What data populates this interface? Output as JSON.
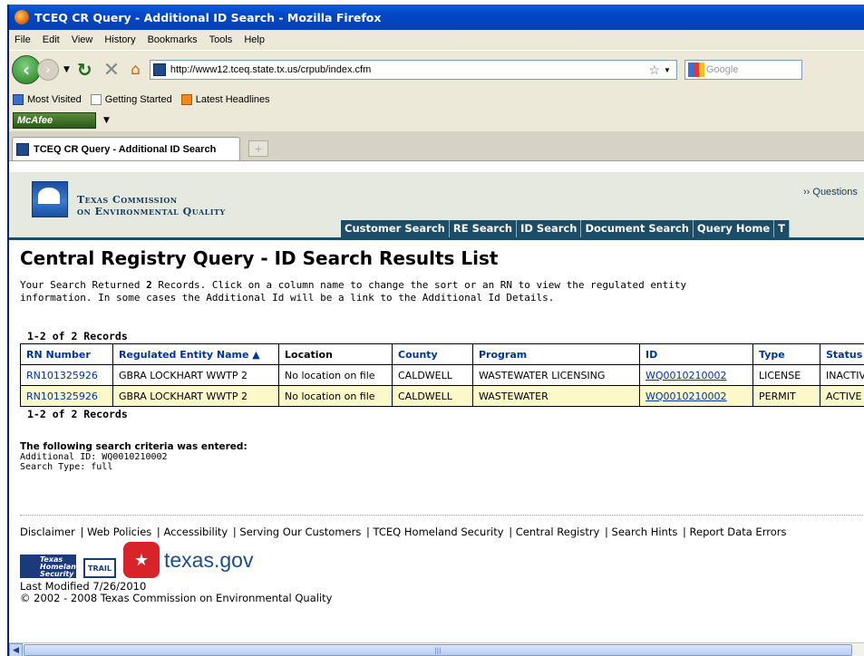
{
  "window": {
    "title": "TCEQ CR Query - Additional ID Search - Mozilla Firefox"
  },
  "menu": [
    "File",
    "Edit",
    "View",
    "History",
    "Bookmarks",
    "Tools",
    "Help"
  ],
  "navbar": {
    "url": "http://www12.tceq.state.tx.us/crpub/index.cfm",
    "search_placeholder": "Google"
  },
  "bookmarks": [
    "Most Visited",
    "Getting Started",
    "Latest Headlines"
  ],
  "mcafee": {
    "label": "McAfee"
  },
  "tab": {
    "title": "TCEQ CR Query - Additional ID Search",
    "new_tab": "+"
  },
  "site": {
    "org_line1": "Texas Commission",
    "org_line2": "on Environmental Quality",
    "questions": "›› Questions",
    "nav": [
      "Customer Search",
      "RE Search",
      "ID Search",
      "Document Search",
      "Query Home",
      "T"
    ]
  },
  "main": {
    "title": "Central Registry Query - ID Search Results List",
    "desc_prefix": "Your Search Returned ",
    "desc_count": "2",
    "desc_suffix": " Records. Click on a column name to change the sort or an RN to view the regulated entity information. In some cases the Additional Id will be a link to the Additional Id Details.",
    "records_label": "1-2 of 2 Records",
    "columns": [
      "RN Number",
      "Regulated Entity Name ▲",
      "Location",
      "County",
      "Program",
      "ID",
      "Type",
      "Status"
    ],
    "rows": [
      [
        "RN101325926",
        "GBRA LOCKHART WWTP 2",
        "No location on file",
        "CALDWELL",
        "WASTEWATER LICENSING",
        "WQ0010210002",
        "LICENSE",
        "INACTIVE"
      ],
      [
        "RN101325926",
        "GBRA LOCKHART WWTP 2",
        "No location on file",
        "CALDWELL",
        "WASTEWATER",
        "WQ0010210002",
        "PERMIT",
        "ACTIVE"
      ]
    ],
    "criteria_heading": "The following search criteria was entered:",
    "criteria_id": "Additional ID: WQ0010210002",
    "criteria_type": "Search Type: full"
  },
  "footer": {
    "links": [
      "Disclaimer",
      "Web Policies",
      "Accessibility",
      "Serving Our Customers",
      "TCEQ Homeland Security",
      "Central Registry",
      "Search Hints",
      "Report Data Errors"
    ],
    "homeland": "Texas Homeland Security",
    "trail": "TRAIL",
    "txgov": "texas.gov",
    "modified": "Last Modified 7/26/2010",
    "copyright": "© 2002 - 2008 Texas Commission on Environmental Quality"
  }
}
